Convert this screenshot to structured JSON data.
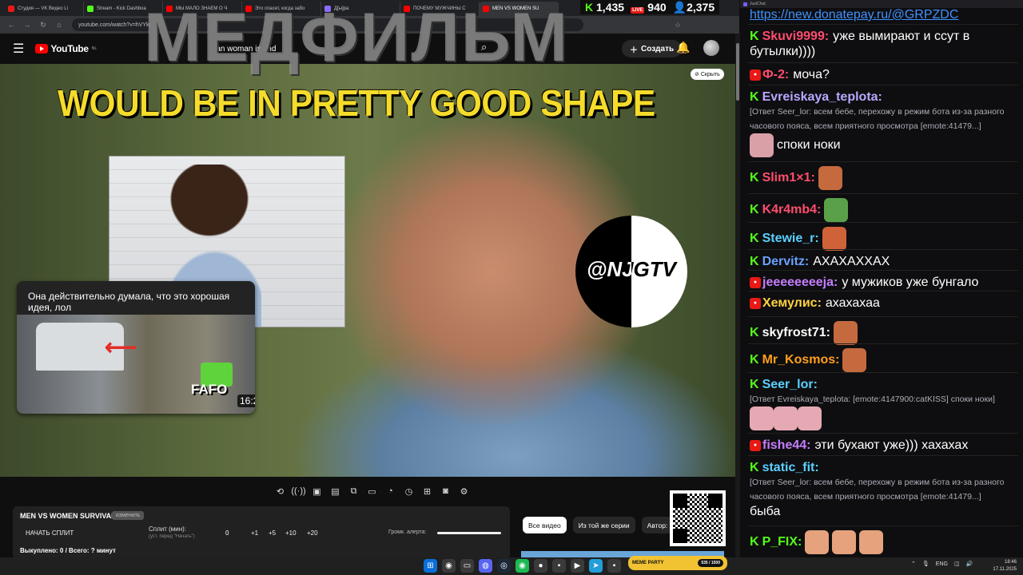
{
  "browser": {
    "tabs": [
      {
        "label": "Студия — VK Видео Li",
        "color": "#e91916",
        "active": false
      },
      {
        "label": "Stream - Kick Dashboa",
        "color": "#53fc18",
        "active": false
      },
      {
        "label": "МЫ МАЛО ЗНАЕМ О Ч",
        "color": "#ff0000",
        "active": false
      },
      {
        "label": "Это спасет, когда забо",
        "color": "#ff0000",
        "active": false
      },
      {
        "label": "Д[ы]ра",
        "color": "#8a6cff",
        "active": false
      },
      {
        "label": "ПОЧЕМУ МУЖЧИНЫ С",
        "color": "#ff0000",
        "active": false
      },
      {
        "label": "MEN VS WOMEN SU",
        "color": "#ff0000",
        "active": true
      }
    ],
    "url": "youtube.com/watch?v=hVYkgo..."
  },
  "stream_stats": {
    "kick_viewers": "1,435",
    "live_viewers": "940",
    "twitch_viewers": "2,375",
    "live_badge": "LIVE"
  },
  "youtube": {
    "logo_text": "YouTube",
    "region": "NL",
    "search_query": "man woman island",
    "create_label": "Создать",
    "watermark": "МЕДФИЛЬМ",
    "hide_label": "Скрыть",
    "video_caption": "WOULD BE IN PRETTY GOOD SHAPE",
    "channel_logo_text": "@NJGTV",
    "card": {
      "title": "Она действительно думала, что это хорошая идея, лол",
      "overlay_text": "FAFO",
      "duration": "16:27"
    },
    "chips": [
      "Все видео",
      "Из той же серии",
      "Автор:"
    ]
  },
  "panel": {
    "title": "MEN VS WOMEN SURVIVAL",
    "badge": "изменить",
    "start_split": "НАЧАТЬ СПЛИТ",
    "split_label": "Сплит (мин):",
    "split_hint": "(уст. перед \"Начать\")",
    "split_value": "0",
    "increments": [
      "+1",
      "+5",
      "+10",
      "+20"
    ],
    "alert_label": "Громк. алерта:",
    "bought": "Выкуплено: 0 / Всего: ? минут"
  },
  "chat": {
    "window_title": "JustChat",
    "link": "https://new.donatepay.ru/@GRPZDC",
    "messages": [
      {
        "platform": "kick",
        "user": "Skuvi9999:",
        "color": "#ff4d6d",
        "text": "уже вымирают и ссут в бутылки))))"
      },
      {
        "platform": "live",
        "user": "Ф-2:",
        "color": "#ff4d6d",
        "text": "моча?"
      },
      {
        "platform": "kick",
        "user": "Evreiskaya_teplota:",
        "color": "#b9a7ff",
        "reply": "[Ответ Seer_lor: всем бебе, перехожу в режим бота из-за разного часового пояса, всем приятного просмотра [emote:41479...]",
        "text": "споки ноки"
      },
      {
        "platform": "kick",
        "user": "Slim1×1:",
        "color": "#ff4d6d",
        "text": ""
      },
      {
        "platform": "kick",
        "user": "K4r4mb4:",
        "color": "#ff4d6d",
        "text": ""
      },
      {
        "platform": "kick",
        "user": "Stewie_r:",
        "color": "#5ad1ff",
        "text": ""
      },
      {
        "platform": "kick",
        "user": "Dervitz:",
        "color": "#6aa0ff",
        "text": "АХАХАХХАХ"
      },
      {
        "platform": "live",
        "user": "jeeeeeeeeja:",
        "color": "#c77dff",
        "text": "у мужиков уже бунгало"
      },
      {
        "platform": "live",
        "user": "Хемулис:",
        "color": "#ffd23f",
        "text": "ахахахаа"
      },
      {
        "platform": "kick",
        "user": "skyfrost71:",
        "color": "#ffffff",
        "text": ""
      },
      {
        "platform": "kick",
        "user": "Mr_Kosmos:",
        "color": "#ff9f1c",
        "text": ""
      },
      {
        "platform": "kick",
        "user": "Seer_lor:",
        "color": "#5ad1ff",
        "reply": "[Ответ Evreiskaya_teplota: [emote:4147900:catKISS] споки ноки]",
        "text": ""
      },
      {
        "platform": "live",
        "user": "fishe44:",
        "color": "#c77dff",
        "text": "эти бухают уже))) хахахах"
      },
      {
        "platform": "kick",
        "user": "static_fit:",
        "color": "#5ad1ff",
        "reply": "[Ответ Seer_lor: всем бебе, перехожу в режим бота из-за разного часового пояса, всем приятного просмотра [emote:41479...]",
        "text": "быба"
      },
      {
        "platform": "kick",
        "user": "P_FIX:",
        "color": "#53fc18",
        "text": ""
      }
    ]
  },
  "taskbar": {
    "meme_title": "MEME PARTY",
    "meme_counter": "535 / 1500",
    "lang": "ENG",
    "time": "18:46",
    "date": "17.11.2025"
  }
}
